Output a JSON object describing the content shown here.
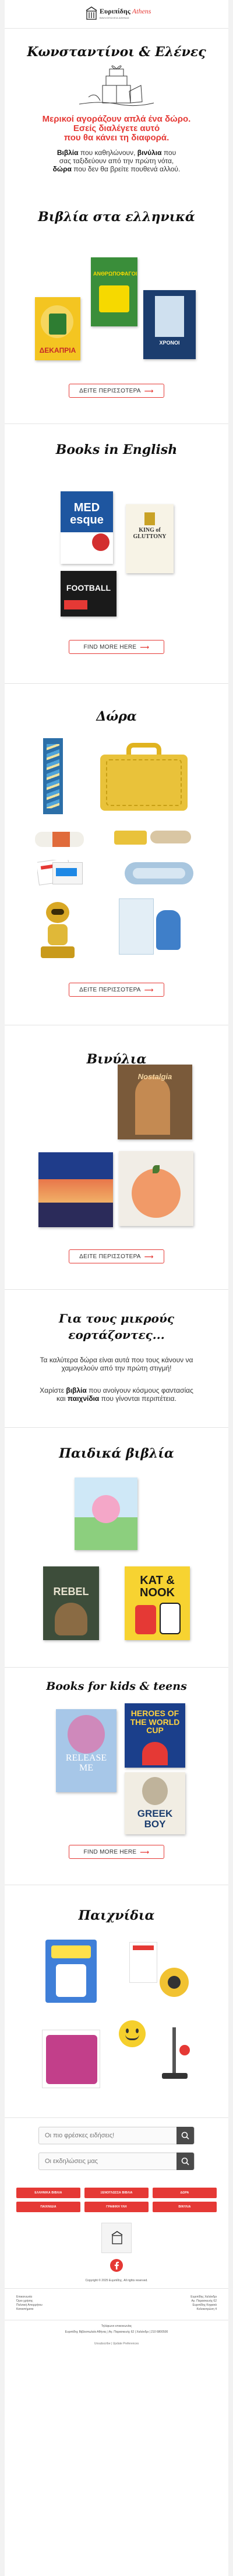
{
  "header": {
    "brand_name": "Ευριπίδης",
    "brand_suffix": "Athens",
    "brand_tagline": "ΒΙΒΛΙΟΠΩΛΕΙΑ ΑΘΗΝΑΣ"
  },
  "hero": {
    "title": "Κωνσταντίνοι & Ελένες",
    "red_heading_lines": [
      "Μερικοί αγοράζουν απλά ένα δώρο.",
      "Εσείς διαλέγετε αυτό",
      "που θα κάνει τη διαφορά."
    ],
    "intro_line1_bold": "Βιβλία",
    "intro_line1_rest": " που καθηλώνουν, ",
    "intro_line1_bold2": "βινύλια",
    "intro_line1_rest2": " που",
    "intro_line2": "σας ταξιδεύουν από την πρώτη νότα,",
    "intro_line3_bold": "δώρα",
    "intro_line3_rest": " που δεν θα βρείτε πουθενά αλλού."
  },
  "sections": {
    "greek_books": {
      "title": "Βιβλία στα ελληνικά",
      "button": "ΔΕΙΤΕ ΠΕΡΙΣΣΟΤΕΡΑ",
      "covers": [
        "ΔΕΚΑΠΡΙΑ",
        "ΑΝΘΡΩΠΟΦΑΓΟΙ",
        "ΧΡΟΝΟΙ"
      ]
    },
    "english_books": {
      "title": "Books in English",
      "button": "FIND MORE HERE",
      "covers": [
        "MED esque",
        "KING of GLUTTONY",
        "FOOTBALL"
      ]
    },
    "gifts": {
      "title": "Δώρα",
      "button": "ΔΕΙΤΕ ΠΕΡΙΣΣΟΤΕΡΑ"
    },
    "vinyl": {
      "title": "Βινύλια",
      "button": "ΔΕΙΤΕ ΠΕΡΙΣΣΟΤΕΡΑ",
      "covers": [
        "Nostalgia"
      ]
    },
    "kids_intro": {
      "title_line1": "Για τους μικρούς",
      "title_line2": "εορτάζοντες...",
      "para1": "Τα καλύτερα δώρα είναι αυτά που τους κάνουν να χαμογελούν από την πρώτη στιγμή!",
      "para2_prefix": "Χαρίστε ",
      "para2_bold1": "βιβλία",
      "para2_mid": " που ανοίγουν κόσμους φαντασίας και ",
      "para2_bold2": "παιχνίδια",
      "para2_suffix": " που γίνονται περιπέτεια."
    },
    "kids_books": {
      "title": "Παιδικά βιβλία",
      "covers": [
        "REBEL",
        "KAT & NOOK"
      ]
    },
    "books_kids_teens": {
      "title": "Books for kids & teens",
      "button": "FIND MORE HERE",
      "covers": [
        "HEROES OF THE WORLD CUP",
        "RELEASE ME",
        "GREEK BOY"
      ]
    },
    "toys": {
      "title": "Παιχνίδια",
      "covers": [
        "fun"
      ]
    }
  },
  "search": {
    "placeholder_1": "Οι πιο φρέσκες ειδήσεις!",
    "placeholder_2": "Οι εκδηλώσεις μας"
  },
  "footer_categories": [
    "ΕΛΛΗΝΙΚΑ ΒΙΒΛΙΑ",
    "ΞΕΝΟΓΛΩΣΣΑ ΒΙΒΛΙΑ",
    "ΔΩΡΑ",
    "ΠΑΙΧΝΙΔΙΑ",
    "ΓΡΑΦΙΚΗ ΥΛΗ",
    "ΒΙΝΥΛΙΑ"
  ],
  "footer": {
    "copyright": "Copyright © 2025 Ευριπίδης. All rights reserved.",
    "links": [
      "Επικοινωνία",
      "Όροι χρήσης",
      "Πολιτική Απορρήτου",
      "Καταστήματα"
    ],
    "address_right": [
      "Ευριπίδης Χαλάνδρι",
      "Αγ. Παρασκευής 62",
      "Ευριπίδης Κηφισιά",
      "Κολοκοτρώνη 4"
    ],
    "bottom_1": "Τηλέφωνο επικοινωνίας",
    "bottom_2": "Ευριπίδης Βιβλιοπωλεία Αθήνας | Αγ. Παρασκευής 62 | Χαλάνδρι | 210 6800500",
    "unsubscribe": "Unsubscribe | Update Preferences"
  },
  "colors": {
    "accent": "#e53935",
    "text": "#222222"
  }
}
